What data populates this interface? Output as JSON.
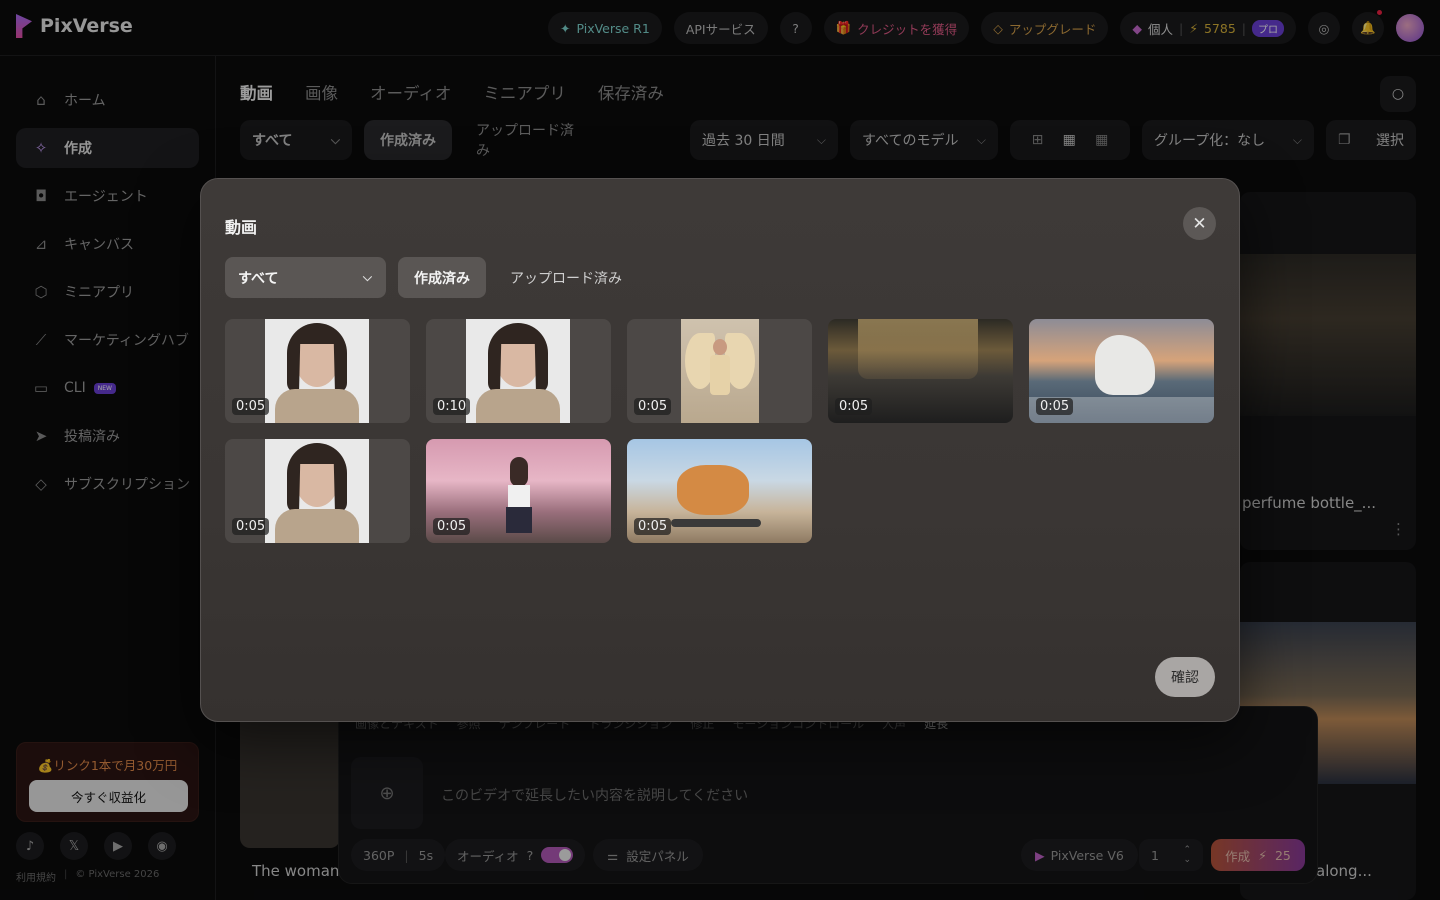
{
  "topbar": {
    "brand": "PixVerse",
    "r1_label": "PixVerse R1",
    "api_label": "APIサービス",
    "credits_label": "クレジットを獲得",
    "upgrade_label": "アップグレード",
    "account_label": "個人",
    "credits_count": "5785",
    "plan_badge": "プロ"
  },
  "sidebar": {
    "items": [
      {
        "label": "ホーム",
        "icon": "home-icon"
      },
      {
        "label": "作成",
        "icon": "sparkle-icon"
      },
      {
        "label": "エージェント",
        "icon": "robot-icon"
      },
      {
        "label": "キャンバス",
        "icon": "canvas-icon"
      },
      {
        "label": "ミニアプリ",
        "icon": "cube-icon"
      },
      {
        "label": "マーケティングハブ",
        "icon": "chart-icon"
      },
      {
        "label": "CLI",
        "icon": "terminal-icon",
        "badge": "NEW"
      },
      {
        "label": "投稿済み",
        "icon": "send-icon"
      },
      {
        "label": "サブスクリプション",
        "icon": "diamond-icon"
      }
    ],
    "promo_text": "💰リンク1本で月30万円",
    "promo_button": "今すぐ収益化",
    "footer_terms": "利用規約",
    "footer_copyright": "© PixVerse 2026"
  },
  "main": {
    "tabs": [
      "動画",
      "画像",
      "オーディオ",
      "ミニアプリ",
      "保存済み"
    ],
    "filters": {
      "all": "すべて",
      "created": "作成済み",
      "uploaded": "アップロード済み",
      "period": "過去 30 日間",
      "models": "すべてのモデル",
      "grouping": "グループ化：なし",
      "select": "選択"
    },
    "bg_titles": {
      "perfume": "perfume bottle_...",
      "woman": "The woman",
      "horse": "along..."
    },
    "composer": {
      "placeholder": "このビデオで延長したい内容を説明してください",
      "resolution": "360P",
      "duration": "5s",
      "audio_label": "オーディオ",
      "settings_label": "設定パネル",
      "model": "PixVerse V6",
      "count": "1",
      "create_label": "作成",
      "create_cost": "25",
      "tools": [
        "画像とテキスト",
        "参照",
        "テンプレート",
        "トランジション",
        "修正",
        "モーションコントロール",
        "人声",
        "延長"
      ]
    }
  },
  "modal": {
    "title": "動画",
    "dropdown": "すべて",
    "tab_created": "作成済み",
    "tab_uploaded": "アップロード済み",
    "confirm": "確認",
    "videos": [
      {
        "duration": "0:05",
        "subject": "portrait"
      },
      {
        "duration": "0:10",
        "subject": "portrait"
      },
      {
        "duration": "0:05",
        "subject": "angel"
      },
      {
        "duration": "0:05",
        "subject": "perfume"
      },
      {
        "duration": "0:05",
        "subject": "horse"
      },
      {
        "duration": "0:05",
        "subject": "portrait"
      },
      {
        "duration": "0:05",
        "subject": "sakura"
      },
      {
        "duration": "0:05",
        "subject": "corgi"
      }
    ]
  }
}
